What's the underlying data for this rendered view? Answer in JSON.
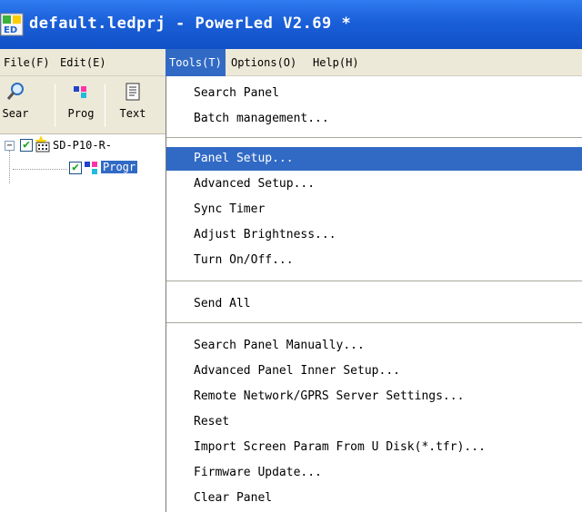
{
  "window": {
    "title": "default.ledprj - PowerLed V2.69 *",
    "icon": "led-app-icon"
  },
  "menubar": {
    "items": [
      {
        "label": "File(F)"
      },
      {
        "label": "Edit(E)"
      },
      {
        "label": "Tools(T)",
        "active": true
      },
      {
        "label": "Options(O)"
      },
      {
        "label": "Help(H)"
      }
    ]
  },
  "toolbar": {
    "buttons": [
      {
        "label": "Sear",
        "icon": "search-icon"
      },
      {
        "label": "Prog",
        "icon": "program-icon"
      },
      {
        "label": "Text",
        "icon": "text-icon"
      }
    ]
  },
  "tree": {
    "nodes": [
      {
        "label": "SD-P10-R-",
        "checked": true,
        "expander": "−",
        "icon": "panel-icon"
      },
      {
        "label": "Progr",
        "checked": true,
        "selected": true,
        "icon": "program-icon"
      }
    ]
  },
  "tools_menu": {
    "groups": [
      [
        "Search Panel",
        "Batch management..."
      ],
      [
        "Panel Setup...",
        "Advanced Setup...",
        "Sync Timer",
        "Adjust Brightness...",
        "Turn On/Off..."
      ],
      [
        "Send All"
      ],
      [
        "Search Panel Manually...",
        "Advanced Panel Inner Setup...",
        "Remote Network/GPRS Server Settings...",
        "Reset",
        "Import Screen Param From U Disk(*.tfr)...",
        "Firmware Update...",
        "Clear Panel"
      ]
    ],
    "highlighted": "Panel Setup..."
  },
  "colors": {
    "titlebar": "#1a5fd8",
    "selection": "#316ac5",
    "menubar_bg": "#ece9d8"
  }
}
